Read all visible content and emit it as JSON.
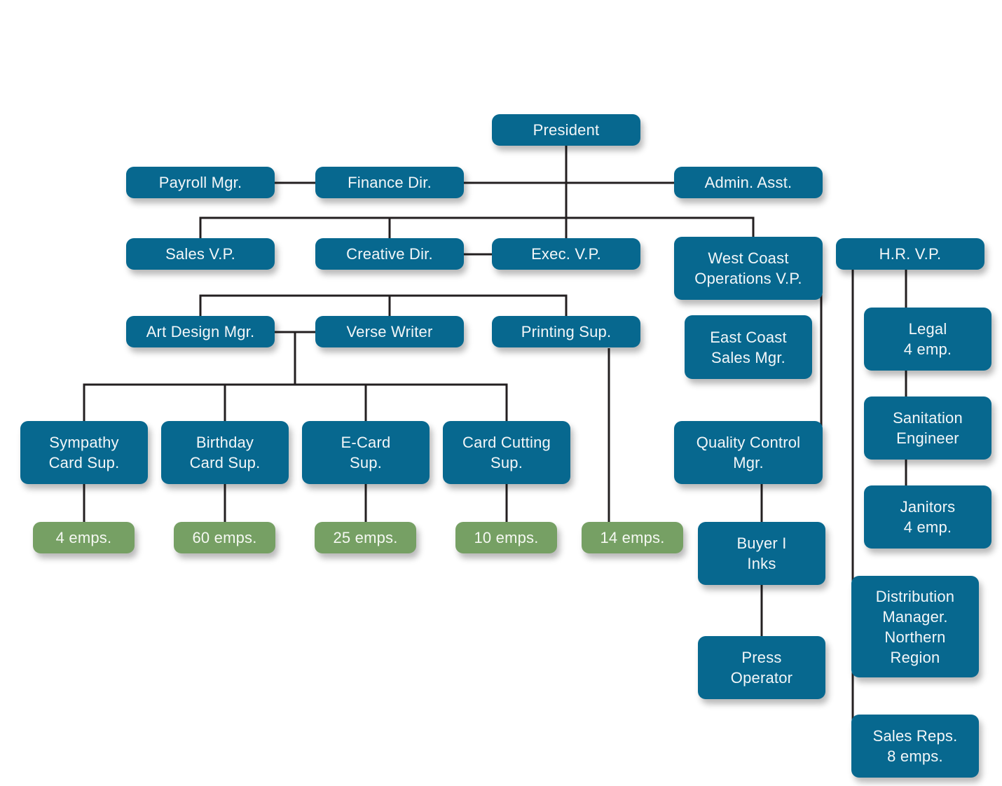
{
  "chart_title": "",
  "colors": {
    "position_box": "#07688f",
    "employee_count_box": "#76a064",
    "connector": "#231f20",
    "background": "#ffffff"
  },
  "nodes": {
    "president": "President",
    "payroll_mgr": "Payroll Mgr.",
    "finance_dir": "Finance Dir.",
    "admin_asst": "Admin. Asst.",
    "sales_vp": "Sales V.P.",
    "creative_dir": "Creative Dir.",
    "exec_vp": "Exec. V.P.",
    "west_coast_ops_vp": "West Coast\nOperations V.P.",
    "hr_vp": "H.R. V.P.",
    "art_design_mgr": "Art Design Mgr.",
    "verse_writer": "Verse Writer",
    "printing_sup": "Printing Sup.",
    "east_coast_sales_mgr": "East Coast\nSales Mgr.",
    "legal": "Legal\n4 emp.",
    "sanitation_engineer": "Sanitation\nEngineer",
    "janitors": "Janitors\n4 emp.",
    "sympathy_card_sup": "Sympathy\nCard Sup.",
    "birthday_card_sup": "Birthday\nCard Sup.",
    "ecard_sup": "E-Card\nSup.",
    "card_cutting_sup": "Card Cutting\nSup.",
    "quality_control_mgr": "Quality Control\nMgr.",
    "buyer_inks": "Buyer I\nInks",
    "press_operator": "Press\nOperator",
    "distribution_manager": "Distribution\nManager.\nNorthern\nRegion",
    "sales_reps": "Sales Reps.\n8 emps.",
    "emps_sympathy": "4 emps.",
    "emps_birthday": "60 emps.",
    "emps_ecard": "25 emps.",
    "emps_card_cutting": "10 emps.",
    "emps_printing": "14 emps."
  }
}
